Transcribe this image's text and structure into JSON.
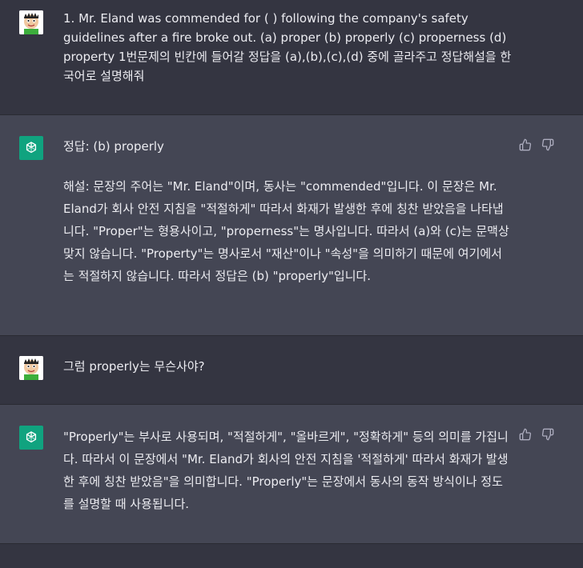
{
  "conversation": {
    "messages": [
      {
        "role": "user",
        "text": "1. Mr. Eland was commended for (  ) following the company's safety guidelines after a fire broke out. (a)  proper (b) properly (c) properness (d) property 1번문제의 빈칸에 들어갈 정답을 (a),(b),(c),(d) 중에 골라주고 정답해설을 한국어로 설명해줘"
      },
      {
        "role": "assistant",
        "paragraphs": [
          "정답: (b) properly",
          "해설: 문장의 주어는 \"Mr. Eland\"이며, 동사는 \"commended\"입니다. 이 문장은 Mr. Eland가 회사 안전 지침을 \"적절하게\" 따라서 화재가 발생한 후에 칭찬 받았음을 나타냅니다. \"Proper\"는 형용사이고, \"properness\"는 명사입니다. 따라서 (a)와 (c)는 문맥상 맞지 않습니다. \"Property\"는 명사로서 \"재산\"이나 \"속성\"을 의미하기 때문에 여기에서는 적절하지 않습니다. 따라서 정답은 (b) \"properly\"입니다."
        ]
      },
      {
        "role": "user",
        "text": "그럼 properly는 무슨사야?"
      },
      {
        "role": "assistant",
        "paragraphs": [
          "\"Properly\"는 부사로 사용되며, \"적절하게\", \"올바르게\", \"정확하게\" 등의 의미를 가집니다. 따라서 이 문장에서 \"Mr. Eland가 회사의 안전 지침을 '적절하게' 따라서 화재가 발생한 후에 칭찬 받았음\"을 의미합니다. \"Properly\"는 문장에서 동사의 동작 방식이나 정도를 설명할 때 사용됩니다."
        ]
      }
    ]
  },
  "icons": {
    "user_avatar": "user-avatar-cartoon",
    "assistant_avatar": "openai-logo-icon",
    "like": "thumbs-up-icon",
    "dislike": "thumbs-down-icon"
  },
  "colors": {
    "user_bg": "#343541",
    "assistant_bg": "#444654",
    "assistant_avatar_bg": "#10a37f",
    "text": "#ececf1",
    "icon": "#acacbe"
  }
}
